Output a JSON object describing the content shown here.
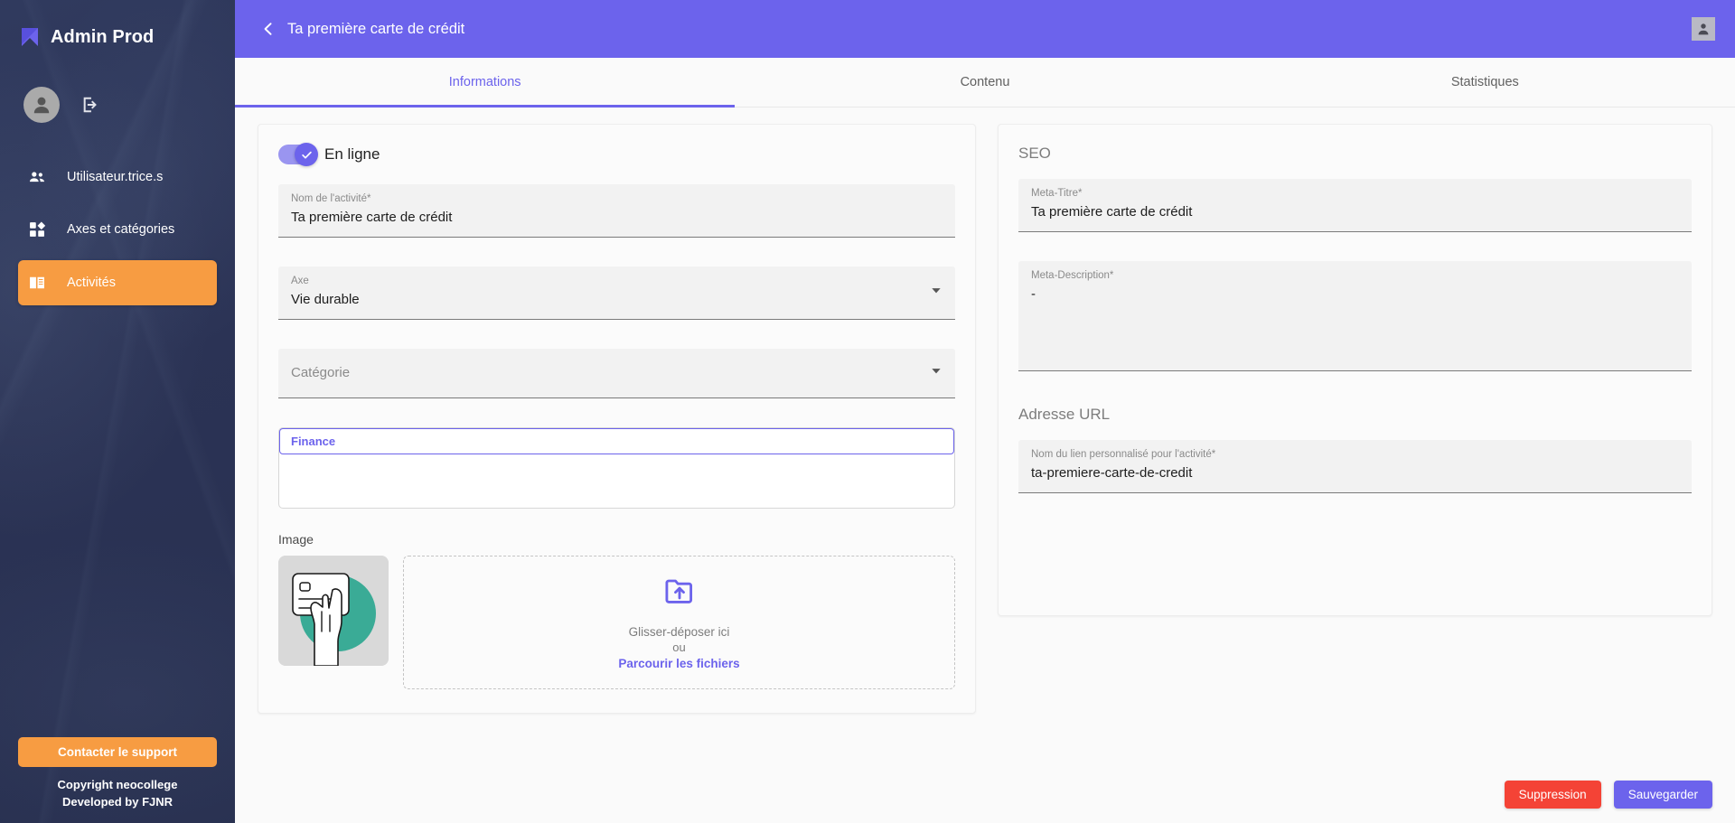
{
  "sidebar": {
    "brand": "Admin Prod",
    "brand_logo_icon": "bookmark-logo-icon",
    "avatar_icon": "user-avatar-icon",
    "logout_icon": "logout-icon",
    "items": [
      {
        "label": "Utilisateur.trice.s",
        "icon": "people-icon",
        "active": false
      },
      {
        "label": "Axes et catégories",
        "icon": "dashboard-blocks-icon",
        "active": false
      },
      {
        "label": "Activités",
        "icon": "book-icon",
        "active": true
      }
    ],
    "support_button": "Contacter le support",
    "copyright": "Copyright neocollege",
    "developed_by": "Developed by FJNR",
    "accent_color": "#f79c42",
    "background_color": "#2b3355"
  },
  "topbar": {
    "back_icon": "chevron-left-icon",
    "title": "Ta première carte de crédit",
    "account_icon": "account-box-icon",
    "background_color": "#6c63ec"
  },
  "tabs": [
    {
      "label": "Informations",
      "active": true
    },
    {
      "label": "Contenu",
      "active": false
    },
    {
      "label": "Statistiques",
      "active": false
    }
  ],
  "left_panel": {
    "toggle": {
      "label": "En ligne",
      "checked": true,
      "check_icon": "check-icon"
    },
    "name_field": {
      "label": "Nom de l'activité*",
      "value": "Ta première carte de crédit"
    },
    "axe_field": {
      "label": "Axe",
      "value": "Vie durable",
      "arrow_icon": "chevron-down-icon"
    },
    "categorie_field": {
      "label": "",
      "placeholder": "Catégorie",
      "value": "",
      "arrow_icon": "chevron-down-icon"
    },
    "tags": [
      "Finance"
    ],
    "image_section_label": "Image",
    "thumbnail_alt": "illustration-carte-de-credit",
    "dropzone": {
      "upload_icon": "folder-upload-icon",
      "text": "Glisser-déposer ici",
      "or": "ou",
      "link": "Parcourir les fichiers"
    }
  },
  "right_panel": {
    "seo_title": "SEO",
    "meta_title_field": {
      "label": "Meta-Titre*",
      "value": "Ta première carte de crédit"
    },
    "meta_description_field": {
      "label": "Meta-Description*",
      "value": "-"
    },
    "url_title": "Adresse URL",
    "url_field": {
      "label": "Nom du lien personnalisé pour l'activité*",
      "value": "ta-premiere-carte-de-credit"
    }
  },
  "actions": {
    "delete_label": "Suppression",
    "save_label": "Sauvegarder",
    "delete_color": "#f44336",
    "save_color": "#6c63ec"
  }
}
